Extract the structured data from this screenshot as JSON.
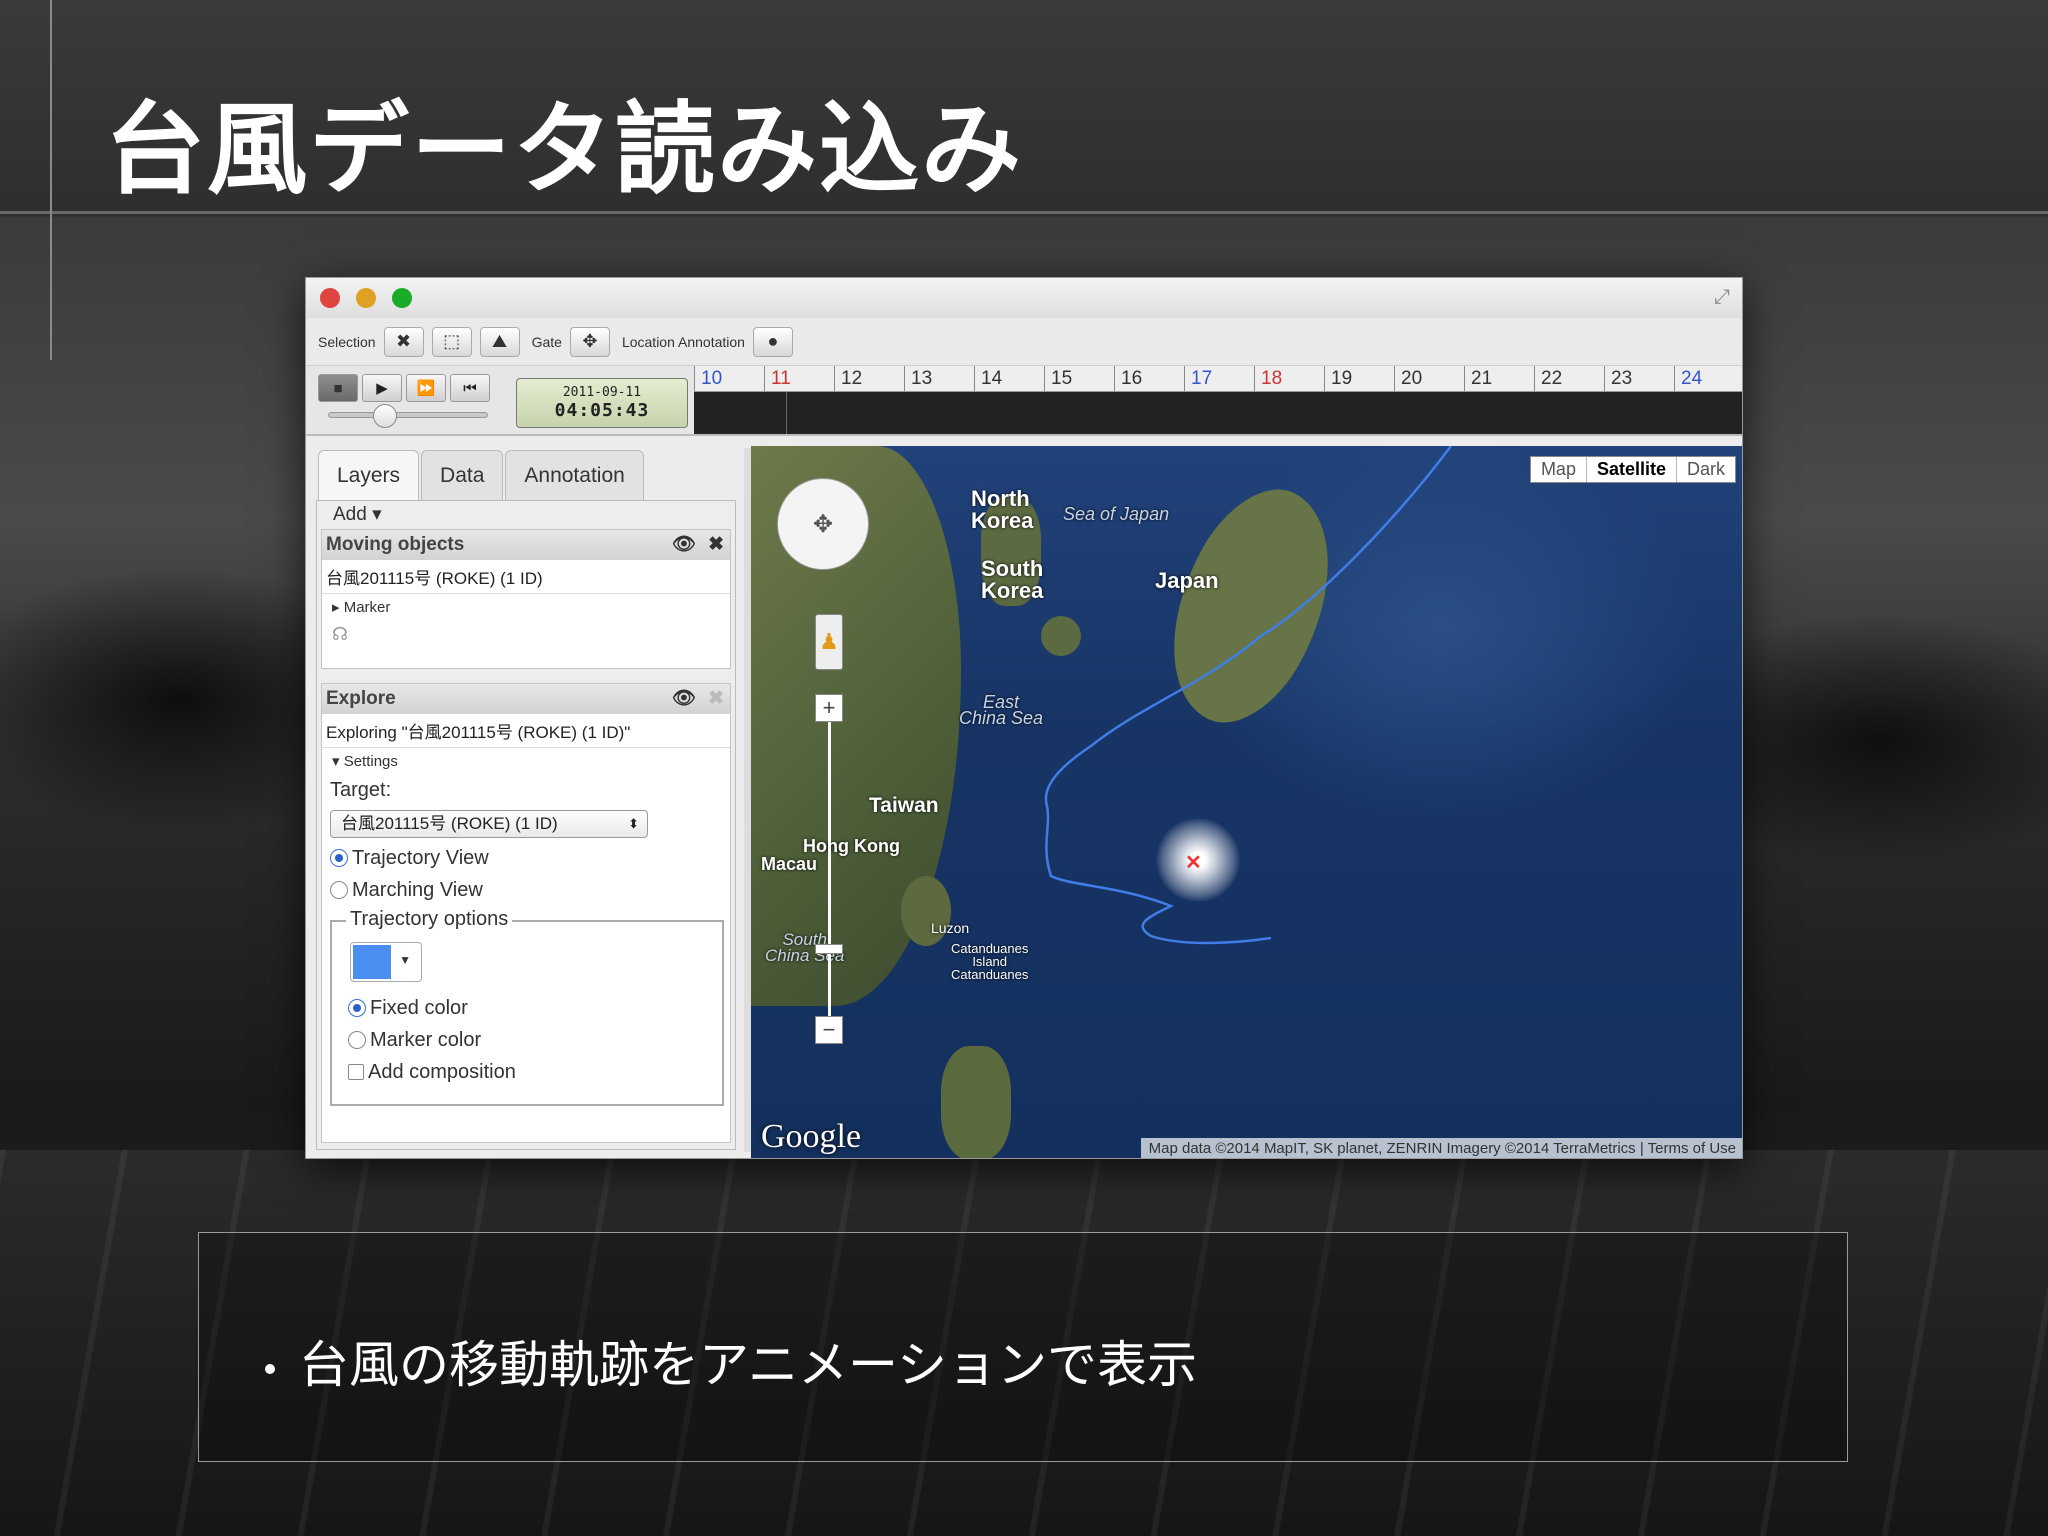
{
  "slide": {
    "title": "台風データ読み込み",
    "bullet": "台風の移動軌跡をアニメーションで表示"
  },
  "toolbar": {
    "selection_label": "Selection",
    "gate_label": "Gate",
    "location_annotation_label": "Location Annotation"
  },
  "player": {
    "date": "2011-09-11",
    "time": "04:05:43",
    "slider_position": 0.35
  },
  "timeline": {
    "ticks": [
      {
        "label": "10",
        "color": "blue"
      },
      {
        "label": "11",
        "color": "red"
      },
      {
        "label": "12",
        "color": "normal"
      },
      {
        "label": "13",
        "color": "normal"
      },
      {
        "label": "14",
        "color": "normal"
      },
      {
        "label": "15",
        "color": "normal"
      },
      {
        "label": "16",
        "color": "normal"
      },
      {
        "label": "17",
        "color": "blue"
      },
      {
        "label": "18",
        "color": "red"
      },
      {
        "label": "19",
        "color": "normal"
      },
      {
        "label": "20",
        "color": "normal"
      },
      {
        "label": "21",
        "color": "normal"
      },
      {
        "label": "22",
        "color": "normal"
      },
      {
        "label": "23",
        "color": "normal"
      },
      {
        "label": "24",
        "color": "blue"
      }
    ]
  },
  "left_panel": {
    "tabs": [
      "Layers",
      "Data",
      "Annotation"
    ],
    "add_label": "Add ▾",
    "moving_objects": {
      "header": "Moving objects",
      "item": "台風201115号 (ROKE) (1 ID)",
      "marker_label": "Marker"
    },
    "explore": {
      "header": "Explore",
      "exploring_text": "Exploring \"台風201115号 (ROKE) (1 ID)\"",
      "settings_label": "Settings",
      "target_label": "Target:",
      "target_value": "台風201115号 (ROKE) (1 ID)",
      "trajectory_view": "Trajectory View",
      "marching_view": "Marching View",
      "trajectory_options": "Trajectory options",
      "swatch_color": "#4a8ef0",
      "fixed_color": "Fixed color",
      "marker_color": "Marker color",
      "add_composition": "Add composition"
    }
  },
  "map": {
    "type_buttons": [
      "Map",
      "Satellite",
      "Dark"
    ],
    "active_type": "Satellite",
    "labels": {
      "north_korea": "North\nKorea",
      "south_korea": "South\nKorea",
      "japan": "Japan",
      "taiwan": "Taiwan",
      "hong_kong": "Hong Kong",
      "macau": "Macau",
      "luzon": "Luzon",
      "catanduanes": "Catanduanes\nIsland\nCatanduanes",
      "sea_of_japan": "Sea of Japan",
      "east_china_sea": "East\nChina Sea",
      "south_china_sea": "South\nChina Sea"
    },
    "logo": "Google",
    "attribution": "Map data ©2014 MapIT, SK planet, ZENRIN Imagery ©2014 TerraMetrics  |  Terms of Use",
    "track_color": "#3f7ee8"
  }
}
